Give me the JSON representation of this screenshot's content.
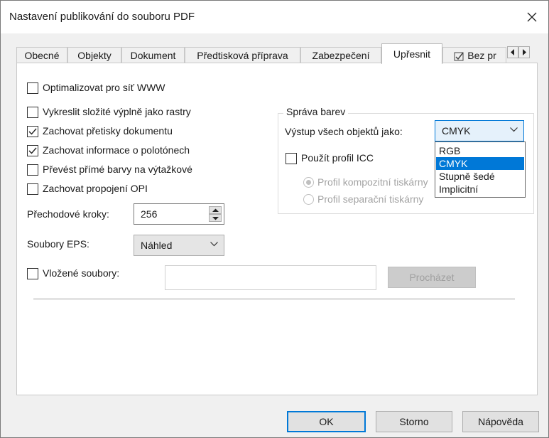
{
  "window": {
    "title": "Nastavení publikování do souboru PDF"
  },
  "tabs": [
    {
      "label": "Obecné"
    },
    {
      "label": "Objekty"
    },
    {
      "label": "Dokument"
    },
    {
      "label": "Předtisková příprava"
    },
    {
      "label": "Zabezpečení"
    },
    {
      "label": "Upřesnit",
      "active": true
    },
    {
      "label": "Bez pr"
    }
  ],
  "options": {
    "optimize_web": {
      "label": "Optimalizovat pro síť WWW",
      "checked": false
    },
    "render_fills": {
      "label": "Vykreslit složité výplně jako rastry",
      "checked": false
    },
    "keep_overprints": {
      "label": "Zachovat přetisky dokumentu",
      "checked": true
    },
    "keep_halftone": {
      "label": "Zachovat informace o polotónech",
      "checked": true
    },
    "convert_spot": {
      "label": "Převést přímé barvy na výtažkové",
      "checked": false
    },
    "keep_opi": {
      "label": "Zachovat propojení OPI",
      "checked": false
    }
  },
  "fountain_steps": {
    "label": "Přechodové kroky:",
    "value": "256"
  },
  "eps_files": {
    "label": "Soubory EPS:",
    "value": "Náhled"
  },
  "embedded_files": {
    "label": "Vložené soubory:",
    "checked": false,
    "value": "",
    "browse_label": "Procházet"
  },
  "color_management": {
    "title": "Správa barev",
    "output_label": "Výstup všech objektů jako:",
    "output_value": "CMYK",
    "dropdown_options": [
      "RGB",
      "CMYK",
      "Stupně šedé",
      "Implicitní"
    ],
    "selected_option": "CMYK",
    "use_icc": {
      "label": "Použít profil ICC",
      "checked": false
    },
    "composite_profile": "Profil kompozitní tiskárny",
    "separation_profile": "Profil separační tiskárny"
  },
  "footer": {
    "ok": "OK",
    "cancel": "Storno",
    "help": "Nápověda"
  },
  "colors": {
    "accent": "#0078d7",
    "dialog_bg": "#f0f0f0",
    "panel_bg": "#ffffff"
  }
}
